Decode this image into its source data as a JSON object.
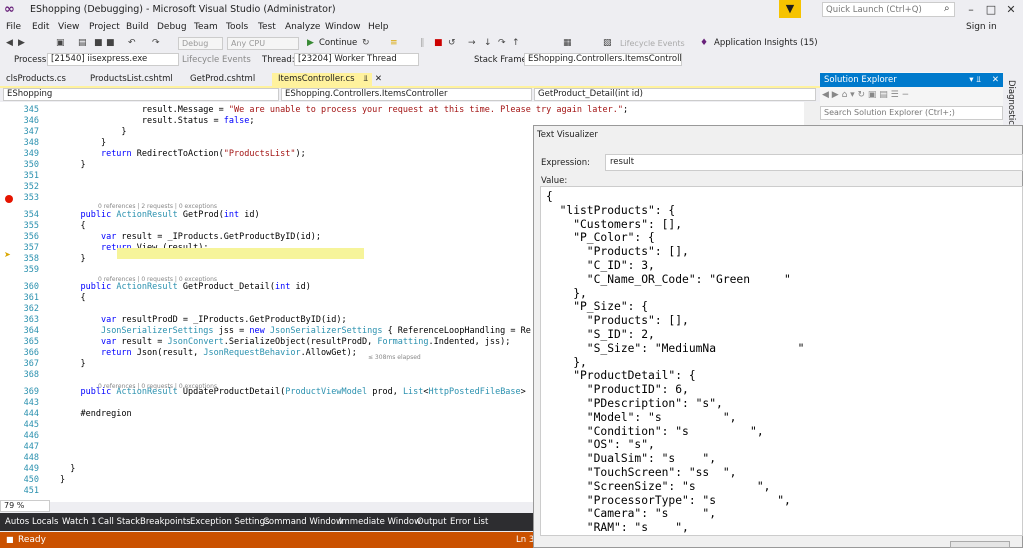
{
  "window": {
    "title": "EShopping (Debugging) - Microsoft Visual Studio (Administrator)",
    "quick_launch_placeholder": "Quick Launch (Ctrl+Q)",
    "sign_in": "Sign in"
  },
  "menu": [
    "File",
    "Edit",
    "View",
    "Project",
    "Build",
    "Debug",
    "Team",
    "Tools",
    "Test",
    "Analyze",
    "Window",
    "Help"
  ],
  "toolbar": {
    "config": "Debug",
    "platform": "Any CPU",
    "continue_label": "Continue",
    "lifecycle_events": "Lifecycle Events",
    "app_insights": "Application Insights (15)"
  },
  "debug_bar": {
    "process_label": "Process:",
    "process_value": "[21540] iisexpress.exe",
    "thread_label": "Thread:",
    "thread_value": "[23204] Worker Thread",
    "stack_label": "Stack Frame:",
    "stack_value": "EShopping.Controllers.ItemsController.Ge"
  },
  "tabs": [
    "clsProducts.cs",
    "ProductsList.cshtml",
    "GetProd.cshtml",
    "ItemsController.cs"
  ],
  "active_tab": "ItemsController.cs",
  "nav": {
    "project": "EShopping",
    "class": "EShopping.Controllers.ItemsController",
    "member": "GetProduct_Detail(int id)"
  },
  "editor": {
    "lines": [
      {
        "n": "345",
        "code": "                result.Message = \"We are unable to process your request at this time. Please try again later.\";"
      },
      {
        "n": "346",
        "code": "                result.Status = false;"
      },
      {
        "n": "347",
        "code": "            }"
      },
      {
        "n": "348",
        "code": "        }"
      },
      {
        "n": "349",
        "code": "        return RedirectToAction(\"ProductsList\");"
      },
      {
        "n": "350",
        "code": "    }"
      },
      {
        "n": "351",
        "code": ""
      },
      {
        "n": "352",
        "code": ""
      },
      {
        "n": "353",
        "code": ""
      },
      {
        "n": "354",
        "code": "    public ActionResult GetProd(int id)"
      },
      {
        "n": "355",
        "code": "    {"
      },
      {
        "n": "356",
        "code": "        var result = _IProducts.GetProductByID(id);"
      },
      {
        "n": "357",
        "code": "        return View (result);"
      },
      {
        "n": "358",
        "code": "    }"
      },
      {
        "n": "359",
        "code": ""
      },
      {
        "n": "360",
        "code": "    public ActionResult GetProduct_Detail(int id)"
      },
      {
        "n": "361",
        "code": "    {"
      },
      {
        "n": "362",
        "code": ""
      },
      {
        "n": "363",
        "code": "        var resultProdD = _IProducts.GetProductByID(id);"
      },
      {
        "n": "364",
        "code": "        JsonSerializerSettings jss = new JsonSerializerSettings { ReferenceLoopHandling = Re"
      },
      {
        "n": "365",
        "code": "        var result = JsonConvert.SerializeObject(resultProdD, Formatting.Indented, jss);"
      },
      {
        "n": "366",
        "code": "        return Json(result, JsonRequestBehavior.AllowGet);"
      },
      {
        "n": "367",
        "code": "    }"
      },
      {
        "n": "368",
        "code": ""
      },
      {
        "n": "369",
        "code": "    public ActionResult UpdateProductDetail(ProductViewModel prod, List<HttpPostedFileBase>"
      },
      {
        "n": "443",
        "code": ""
      },
      {
        "n": "444",
        "code": "    #endregion"
      },
      {
        "n": "445",
        "code": ""
      },
      {
        "n": "446",
        "code": ""
      },
      {
        "n": "447",
        "code": ""
      },
      {
        "n": "448",
        "code": ""
      },
      {
        "n": "449",
        "code": "  }"
      },
      {
        "n": "450",
        "code": "}"
      },
      {
        "n": "451",
        "code": ""
      }
    ],
    "lens_getprod": "0 references | 2 requests | 0 exceptions",
    "lens_detail": "0 references | 0 requests | 0 exceptions",
    "lens_update": "0 references | 0 requests | 0 exceptions",
    "elapsed": "≤ 308ms elapsed",
    "zoom": "79 %"
  },
  "bottom_tabs": [
    "Autos",
    "Locals",
    "Watch 1",
    "Call Stack",
    "Breakpoints",
    "Exception Settings",
    "Command Window",
    "Immediate Window",
    "Output",
    "Error List"
  ],
  "status": {
    "text": "Ready",
    "ln": "Ln 3"
  },
  "solution_explorer": {
    "title": "Solution Explorer",
    "search_placeholder": "Search Solution Explorer (Ctrl+;)"
  },
  "diagnostic_label": "Diagnostic Tools",
  "text_visualizer": {
    "title": "Text Visualizer",
    "expression_label": "Expression:",
    "expression_value": "result",
    "value_label": "Value:",
    "value_text": "{\n  \"listProducts\": {\n    \"Customers\": [],\n    \"P_Color\": {\n      \"Products\": [],\n      \"C_ID\": 3,\n      \"C_Name_OR_Code\": \"Green     \"\n    },\n    \"P_Size\": {\n      \"Products\": [],\n      \"S_ID\": 2,\n      \"S_Size\": \"MediumNa            \"\n    },\n    \"ProductDetail\": {\n      \"ProductID\": 6,\n      \"PDescription\": \"s\",\n      \"Model\": \"s         \",\n      \"Condition\": \"s         \",\n      \"OS\": \"s\",\n      \"DualSim\": \"s    \",\n      \"TouchScreen\": \"ss  \",\n      \"ScreenSize\": \"s         \",\n      \"ProcessorType\": \"s         \",\n      \"Camera\": \"s     \",\n      \"RAM\": \"s    \","
  }
}
